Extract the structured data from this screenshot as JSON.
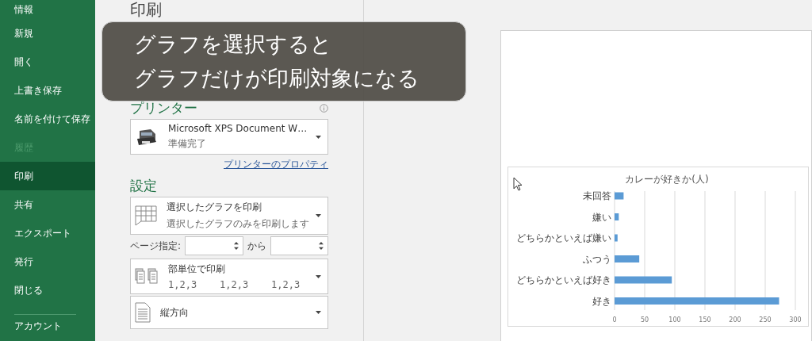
{
  "sidebar": {
    "items": [
      {
        "label": "情報",
        "selected": false,
        "disabled": false
      },
      {
        "label": "新規",
        "selected": false,
        "disabled": false
      },
      {
        "label": "開く",
        "selected": false,
        "disabled": false
      },
      {
        "label": "上書き保存",
        "selected": false,
        "disabled": false
      },
      {
        "label": "名前を付けて保存",
        "selected": false,
        "disabled": false
      },
      {
        "label": "履歴",
        "selected": false,
        "disabled": true
      },
      {
        "label": "印刷",
        "selected": true,
        "disabled": false
      },
      {
        "label": "共有",
        "selected": false,
        "disabled": false
      },
      {
        "label": "エクスポート",
        "selected": false,
        "disabled": false
      },
      {
        "label": "発行",
        "selected": false,
        "disabled": false
      },
      {
        "label": "閉じる",
        "selected": false,
        "disabled": false
      }
    ],
    "footer_items": [
      {
        "label": "アカウント",
        "selected": false,
        "disabled": false
      }
    ]
  },
  "page_title": "印刷",
  "caption": [
    "グラフを選択すると",
    "グラフだけが印刷対象になる"
  ],
  "printer": {
    "heading": "プリンター",
    "name": "Microsoft XPS Document W…",
    "status": "準備完了",
    "properties_link": "プリンターのプロパティ"
  },
  "settings": {
    "heading": "設定",
    "print_what": {
      "title": "選択したグラフを印刷",
      "subtitle": "選択したグラフのみを印刷します"
    },
    "pages": {
      "label": "ページ指定:",
      "to_label": "から"
    },
    "collation": {
      "title": "部単位で印刷",
      "subtitle": "1,2,3    1,2,3    1,2,3"
    },
    "orientation": {
      "title": "縦方向"
    }
  },
  "preview": {
    "chart_data": {
      "type": "bar",
      "orientation": "horizontal",
      "title": "カレーが好きか(人)",
      "categories": [
        "未回答",
        "嫌い",
        "どちらかといえば嫌い",
        "ふつう",
        "どちらかといえば好き",
        "好き"
      ],
      "series": [
        {
          "color": "#5b9bd5",
          "values": [
            15,
            7,
            5,
            41,
            95,
            273
          ]
        }
      ],
      "grid": true,
      "xlim": [
        0,
        300
      ],
      "xticks": [
        0,
        50,
        100,
        150,
        200,
        250,
        300
      ]
    }
  }
}
